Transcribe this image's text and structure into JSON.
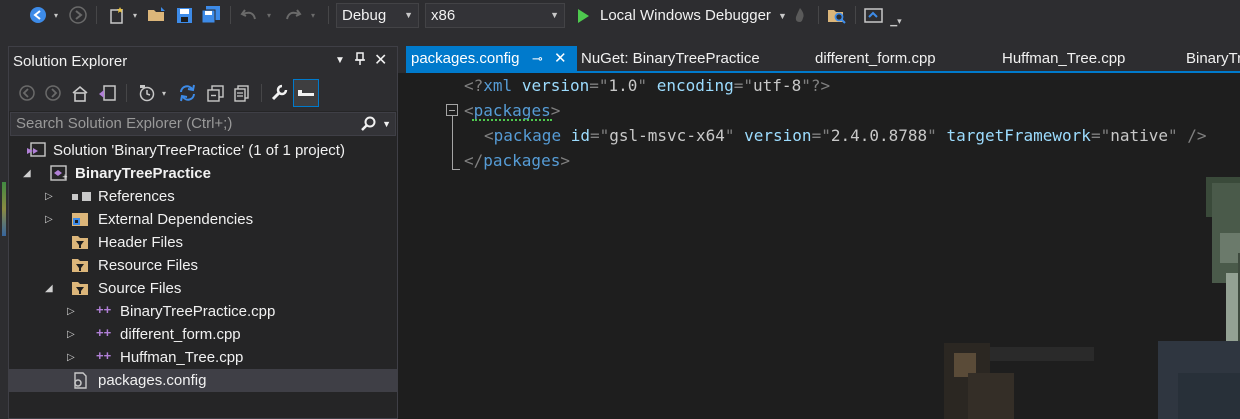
{
  "toolbar": {
    "configuration": "Debug",
    "platform": "x86",
    "run_label": "Local Windows Debugger",
    "icons": [
      "back-icon",
      "forward-icon",
      "new-item-icon",
      "open-folder-icon",
      "save-icon",
      "save-all-icon",
      "undo-icon",
      "redo-icon",
      "hot-reload-icon",
      "find-in-files-icon",
      "browse-icon"
    ]
  },
  "solution_explorer": {
    "title": "Solution Explorer",
    "search_placeholder": "Search Solution Explorer (Ctrl+;)",
    "solution_label": "Solution 'BinaryTreePractice' (1 of 1 project)",
    "project_label": "BinaryTreePractice",
    "items": [
      {
        "label": "References"
      },
      {
        "label": "External Dependencies"
      },
      {
        "label": "Header Files"
      },
      {
        "label": "Resource Files"
      },
      {
        "label": "Source Files"
      },
      {
        "label": "BinaryTreePractice.cpp"
      },
      {
        "label": "different_form.cpp"
      },
      {
        "label": "Huffman_Tree.cpp"
      },
      {
        "label": "packages.config"
      }
    ]
  },
  "tabs": [
    {
      "label": "packages.config"
    },
    {
      "label": "NuGet: BinaryTreePractice"
    },
    {
      "label": "different_form.cpp"
    },
    {
      "label": "Huffman_Tree.cpp"
    },
    {
      "label": "BinaryTr"
    }
  ],
  "code": {
    "line1": {
      "open": "<?",
      "tag": "xml",
      "attr1": "version",
      "eq1": "=\"",
      "val1": "1.0",
      "q1": "\"",
      "attr2": "encoding",
      "eq2": "=\"",
      "val2": "utf-8",
      "close": "\"?>"
    },
    "line2": {
      "open": "<",
      "tag": "packages",
      "close": ">"
    },
    "line3": {
      "open": "<",
      "tag": "package",
      "attr1": "id",
      "eq1": "=\"",
      "val1": "gsl-msvc-x64",
      "q1": "\"",
      "attr2": "version",
      "eq2": "=\"",
      "val2": "2.4.0.8788",
      "q2": "\"",
      "attr3": "targetFramework",
      "eq3": "=\"",
      "val3": "native",
      "close": "\" />"
    },
    "line4": {
      "open": "</",
      "tag": "packages",
      "close": ">"
    }
  },
  "colors": {
    "accent": "#007acc",
    "run": "#4ec94e",
    "xml_tag": "#569cd6",
    "xml_attr": "#9cdcfe",
    "xml_punct": "#808080"
  }
}
